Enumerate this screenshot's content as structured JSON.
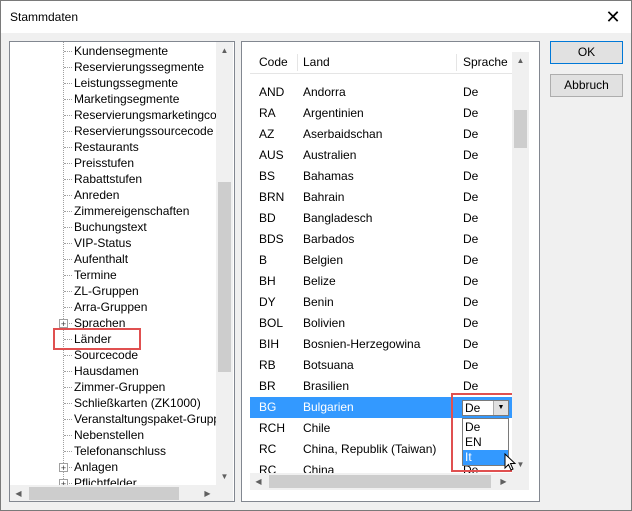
{
  "window": {
    "title": "Stammdaten",
    "close_glyph": "✕"
  },
  "tree": {
    "items": [
      {
        "label": "Kundensegmente"
      },
      {
        "label": "Reservierungssegmente"
      },
      {
        "label": "Leistungssegmente"
      },
      {
        "label": "Marketingsegmente"
      },
      {
        "label": "Reservierungsmarketingcode"
      },
      {
        "label": "Reservierungssourcecode"
      },
      {
        "label": "Restaurants"
      },
      {
        "label": "Preisstufen"
      },
      {
        "label": "Rabattstufen"
      },
      {
        "label": "Anreden"
      },
      {
        "label": "Zimmereigenschaften"
      },
      {
        "label": "Buchungstext"
      },
      {
        "label": "VIP-Status"
      },
      {
        "label": "Aufenthalt"
      },
      {
        "label": "Termine"
      },
      {
        "label": "ZL-Gruppen"
      },
      {
        "label": "Arra-Gruppen"
      },
      {
        "label": "Sprachen",
        "expander": "+"
      },
      {
        "label": "Länder"
      },
      {
        "label": "Sourcecode"
      },
      {
        "label": "Hausdamen"
      },
      {
        "label": "Zimmer-Gruppen"
      },
      {
        "label": "Schließkarten (ZK1000)"
      },
      {
        "label": "Veranstaltungspaket-Gruppen"
      },
      {
        "label": "Nebenstellen"
      },
      {
        "label": "Telefonanschluss"
      },
      {
        "label": "Anlagen",
        "expander": "+"
      },
      {
        "label": "Pflichtfelder",
        "expander": "+"
      }
    ],
    "selected_label": "Länder"
  },
  "table": {
    "headers": {
      "code": "Code",
      "land": "Land",
      "sprache": "Sprache"
    },
    "rows": [
      {
        "code": "AND",
        "land": "Andorra",
        "sprache": "De"
      },
      {
        "code": "RA",
        "land": "Argentinien",
        "sprache": "De"
      },
      {
        "code": "AZ",
        "land": "Aserbaidschan",
        "sprache": "De"
      },
      {
        "code": "AUS",
        "land": "Australien",
        "sprache": "De"
      },
      {
        "code": "BS",
        "land": "Bahamas",
        "sprache": "De"
      },
      {
        "code": "BRN",
        "land": "Bahrain",
        "sprache": "De"
      },
      {
        "code": "BD",
        "land": "Bangladesch",
        "sprache": "De"
      },
      {
        "code": "BDS",
        "land": "Barbados",
        "sprache": "De"
      },
      {
        "code": "B",
        "land": "Belgien",
        "sprache": "De"
      },
      {
        "code": "BH",
        "land": "Belize",
        "sprache": "De"
      },
      {
        "code": "DY",
        "land": "Benin",
        "sprache": "De"
      },
      {
        "code": "BOL",
        "land": "Bolivien",
        "sprache": "De"
      },
      {
        "code": "BIH",
        "land": "Bosnien-Herzegowina",
        "sprache": "De"
      },
      {
        "code": "RB",
        "land": "Botsuana",
        "sprache": "De"
      },
      {
        "code": "BR",
        "land": "Brasilien",
        "sprache": "De"
      },
      {
        "code": "BG",
        "land": "Bulgarien",
        "sprache": "",
        "selected": true
      },
      {
        "code": "RCH",
        "land": "Chile",
        "sprache": "De"
      },
      {
        "code": "RC",
        "land": "China, Republik (Taiwan)",
        "sprache": "De"
      },
      {
        "code": "RC",
        "land": "China",
        "sprache": "De"
      }
    ],
    "combo": {
      "value": "De",
      "options": [
        "De",
        "EN",
        "It"
      ],
      "highlighted": "It"
    }
  },
  "buttons": {
    "ok": "OK",
    "cancel": "Abbruch"
  },
  "colors": {
    "selection": "#3399ff",
    "highlight_box": "#e05050"
  },
  "icons": {
    "scroll_up": "▲",
    "scroll_down": "▼",
    "scroll_left": "◀",
    "scroll_right": "▶",
    "combo_arrow": "▼"
  }
}
